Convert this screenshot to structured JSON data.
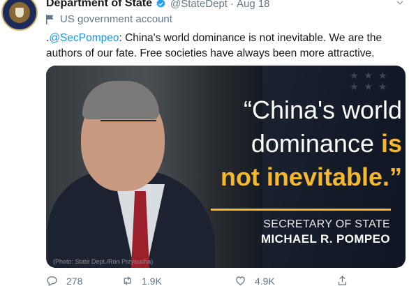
{
  "account": {
    "name": "Department of State",
    "handle": "@StateDept",
    "separator": "·",
    "date": "Aug 18",
    "label": "US government account"
  },
  "tweet": {
    "prefix": ".",
    "mention": "@SecPompeo",
    "body": ": China's world dominance is not inevitable. We are the authors of our fate. Free societies have always been more attractive."
  },
  "media": {
    "quote_line1": "“China's world",
    "quote_line2a": "dominance ",
    "quote_line2b": "is",
    "quote_line3": "not inevitable.",
    "quote_close": "”",
    "title_line1": "SECRETARY OF STATE",
    "title_line2": "MICHAEL R. POMPEO",
    "credit": "(Photo: State Dept./Ron Przysucha)",
    "accent_color": "#f6b92b"
  },
  "actions": {
    "replies": "278",
    "retweets": "1.9K",
    "likes": "4.9K"
  },
  "icons": {
    "verified": "verified-badge-icon",
    "flag": "flag-icon",
    "caret": "chevron-down-icon",
    "reply": "reply-icon",
    "retweet": "retweet-icon",
    "like": "heart-icon",
    "share": "share-icon"
  },
  "colors": {
    "link": "#1b95e0",
    "muted": "#657786",
    "verified": "#1da1f2"
  }
}
